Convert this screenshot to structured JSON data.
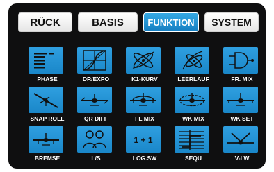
{
  "tabs": [
    {
      "label": "RÜCK",
      "active": false
    },
    {
      "label": "BASIS",
      "active": false
    },
    {
      "label": "FUNKTION",
      "active": true
    },
    {
      "label": "SYSTEM",
      "active": false
    }
  ],
  "functions": [
    {
      "label": "PHASE",
      "icon": "phase-bars-icon"
    },
    {
      "label": "DR/EXPO",
      "icon": "expo-curve-icon"
    },
    {
      "label": "K1-KURV",
      "icon": "channel-curve-icon"
    },
    {
      "label": "LEERLAUF",
      "icon": "idle-propeller-icon"
    },
    {
      "label": "FR. MIX",
      "icon": "free-mix-icon"
    },
    {
      "label": "SNAP ROLL",
      "icon": "snap-roll-plane-icon"
    },
    {
      "label": "QR DIFF",
      "icon": "aileron-diff-plane-icon"
    },
    {
      "label": "FL MIX",
      "icon": "flap-mix-plane-icon"
    },
    {
      "label": "WK MIX",
      "icon": "wing-mix-plane-icon"
    },
    {
      "label": "WK SET",
      "icon": "wing-set-plane-icon"
    },
    {
      "label": "BREMSE",
      "icon": "brake-plane-icon"
    },
    {
      "label": "L/S",
      "icon": "teacher-student-icon"
    },
    {
      "label": "LOG.SW",
      "icon": "logic-switch-icon"
    },
    {
      "label": "SEQU",
      "icon": "sequencer-icon"
    },
    {
      "label": "V-LW",
      "icon": "v-tail-icon"
    }
  ],
  "colors": {
    "accent": "#1a87c9",
    "background": "#0f0f10",
    "label": "#ffffff"
  },
  "logic_text": "1 + 1"
}
